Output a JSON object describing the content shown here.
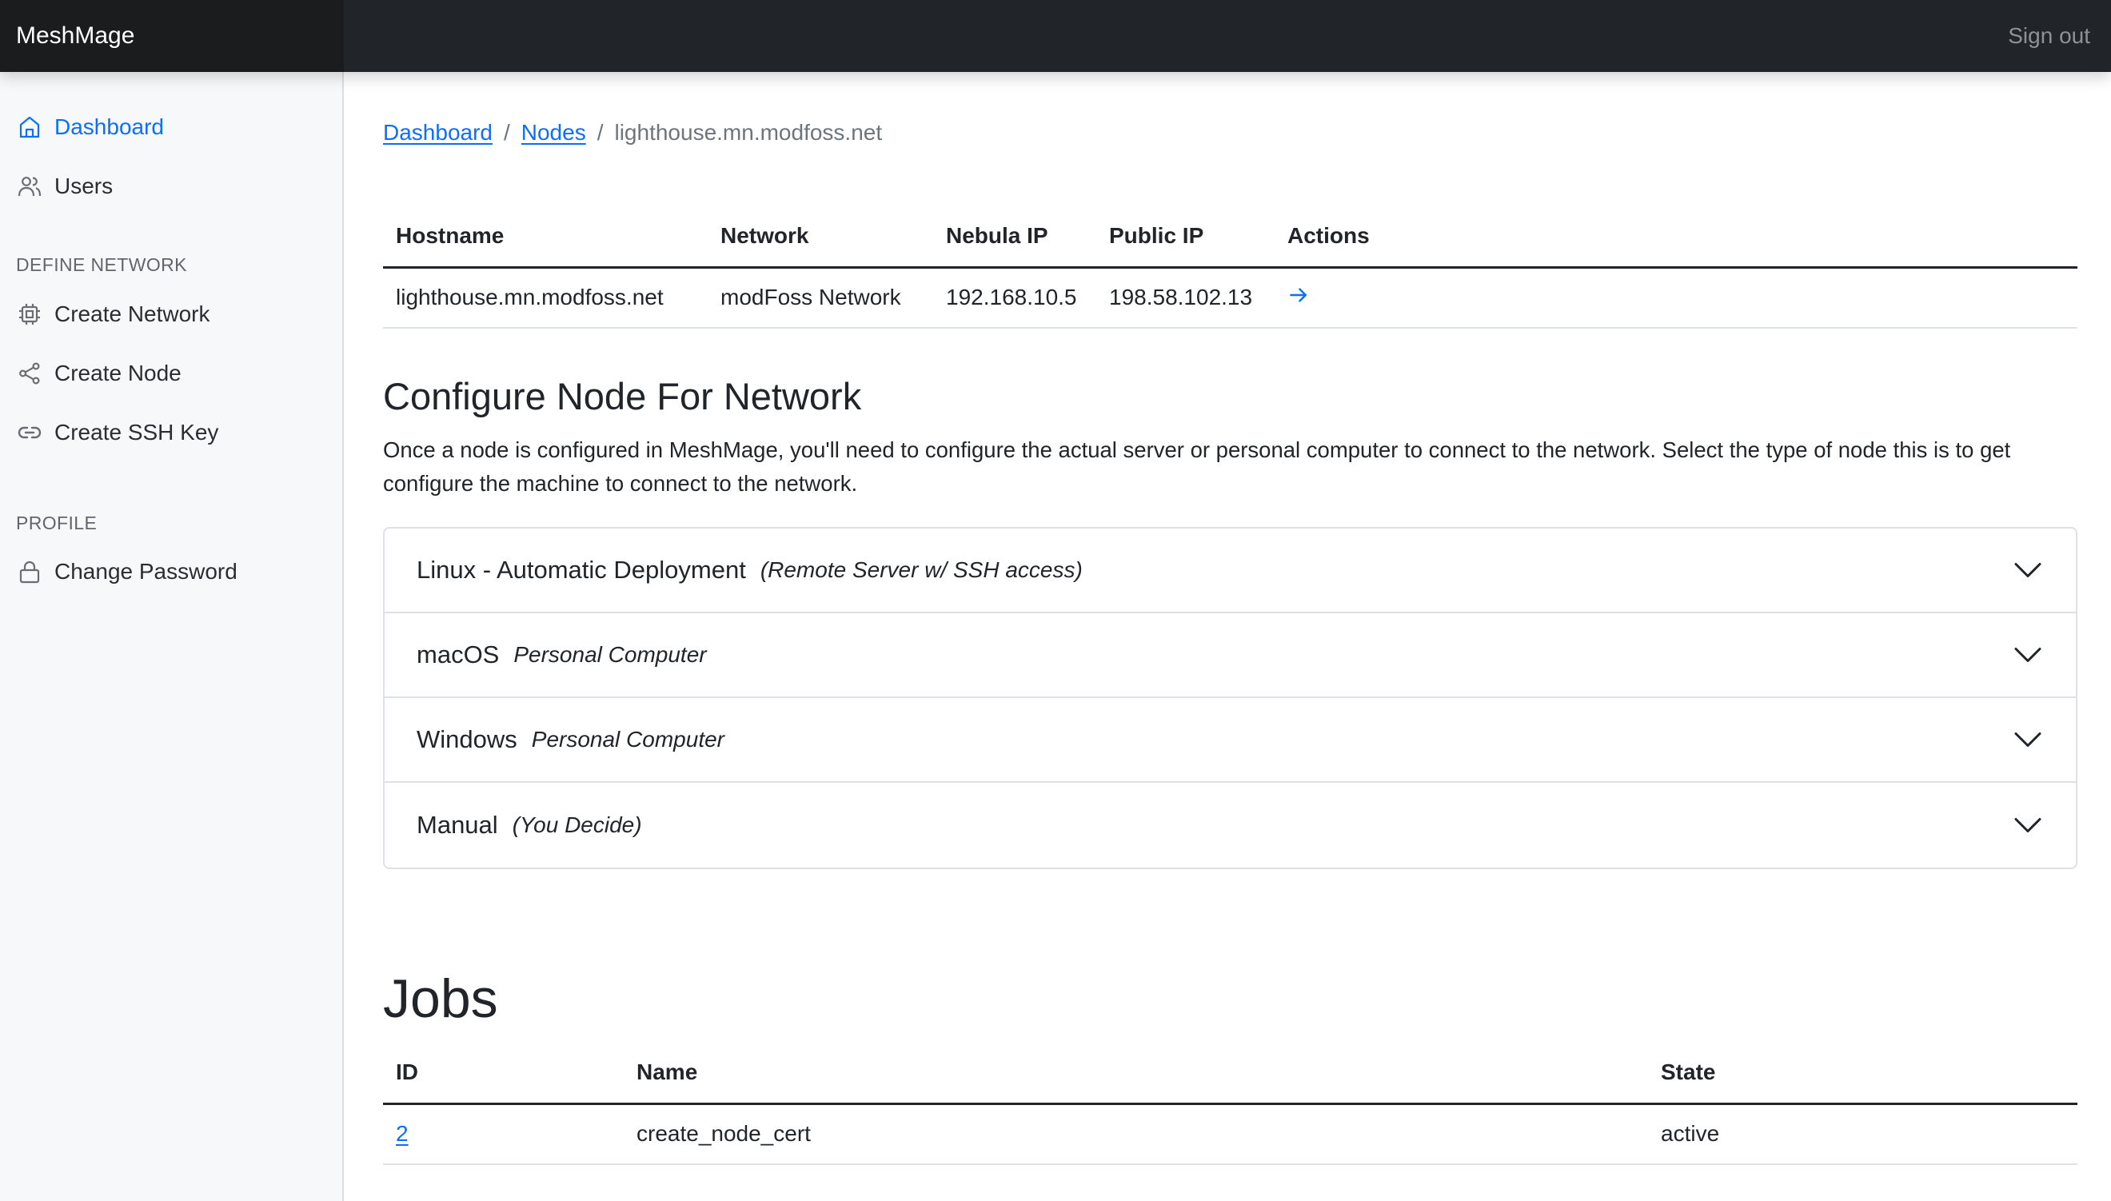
{
  "header": {
    "brand": "MeshMage",
    "sign_out": "Sign out"
  },
  "sidebar": {
    "items": [
      {
        "label": "Dashboard",
        "icon": "home-icon",
        "active": true
      },
      {
        "label": "Users",
        "icon": "users-icon",
        "active": false
      }
    ],
    "sections": [
      {
        "title": "DEFINE NETWORK",
        "items": [
          {
            "label": "Create Network",
            "icon": "cpu-icon"
          },
          {
            "label": "Create Node",
            "icon": "share-icon"
          },
          {
            "label": "Create SSH Key",
            "icon": "link-icon"
          }
        ]
      },
      {
        "title": "PROFILE",
        "items": [
          {
            "label": "Change Password",
            "icon": "lock-icon"
          }
        ]
      }
    ]
  },
  "breadcrumb": {
    "items": [
      {
        "label": "Dashboard",
        "link": true
      },
      {
        "label": "Nodes",
        "link": true
      },
      {
        "label": "lighthouse.mn.modfoss.net",
        "link": false
      }
    ],
    "separator": "/"
  },
  "node_table": {
    "columns": [
      "Hostname",
      "Network",
      "Nebula IP",
      "Public IP",
      "Actions"
    ],
    "rows": [
      {
        "hostname": "lighthouse.mn.modfoss.net",
        "network": "modFoss Network",
        "nebula_ip": "192.168.10.5",
        "public_ip": "198.58.102.13",
        "action_icon": "arrow-right-icon"
      }
    ]
  },
  "configure": {
    "title": "Configure Node For Network",
    "description": "Once a node is configured in MeshMage, you'll need to configure the actual server or personal computer to connect to the network. Select the type of node this is to get configure the machine to connect to the network.",
    "options": [
      {
        "title": "Linux - Automatic Deployment",
        "subtitle": "(Remote Server w/ SSH access)",
        "expanded": false
      },
      {
        "title": "macOS",
        "subtitle": "Personal Computer",
        "expanded": false
      },
      {
        "title": "Windows",
        "subtitle": "Personal Computer",
        "expanded": false
      },
      {
        "title": "Manual",
        "subtitle": "(You Decide)",
        "expanded": false
      }
    ]
  },
  "jobs": {
    "title": "Jobs",
    "columns": [
      "ID",
      "Name",
      "State"
    ],
    "rows": [
      {
        "id": "2",
        "name": "create_node_cert",
        "state": "active"
      }
    ]
  },
  "colors": {
    "accent": "#0d6efd",
    "header_bg": "#212529",
    "sidebar_bg": "#f7f8fa"
  }
}
